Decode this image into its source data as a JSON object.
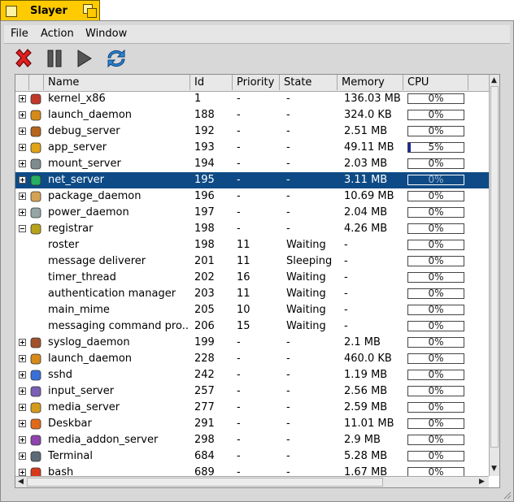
{
  "window": {
    "title": "Slayer"
  },
  "menu": [
    "File",
    "Action",
    "Window"
  ],
  "toolbar": [
    {
      "name": "kill-icon",
      "tip": "Kill"
    },
    {
      "name": "pause-icon",
      "tip": "Suspend"
    },
    {
      "name": "play-icon",
      "tip": "Resume"
    },
    {
      "name": "refresh-icon",
      "tip": "Refresh"
    }
  ],
  "columns": [
    "Name",
    "Id",
    "Priority",
    "State",
    "Memory",
    "CPU"
  ],
  "colors": {
    "selection": "#0e4b86",
    "tab": "#ffcb00",
    "cpu_fill": "#1a2a9a"
  },
  "rows": [
    {
      "type": "team",
      "expander": "plus",
      "icon": "kernel-icon",
      "name": "kernel_x86",
      "id": "1",
      "priority": "-",
      "state": "-",
      "memory": "136.03 MB",
      "cpu": "0%",
      "cpu_value": 0
    },
    {
      "type": "team",
      "expander": "plus",
      "icon": "daemon-icon",
      "name": "launch_daemon",
      "id": "188",
      "priority": "-",
      "state": "-",
      "memory": "324.0 KB",
      "cpu": "0%",
      "cpu_value": 0
    },
    {
      "type": "team",
      "expander": "plus",
      "icon": "debug-icon",
      "name": "debug_server",
      "id": "192",
      "priority": "-",
      "state": "-",
      "memory": "2.51 MB",
      "cpu": "0%",
      "cpu_value": 0
    },
    {
      "type": "team",
      "expander": "plus",
      "icon": "app-server-icon",
      "name": "app_server",
      "id": "193",
      "priority": "-",
      "state": "-",
      "memory": "49.11 MB",
      "cpu": "5%",
      "cpu_value": 0.05
    },
    {
      "type": "team",
      "expander": "plus",
      "icon": "disk-icon",
      "name": "mount_server",
      "id": "194",
      "priority": "-",
      "state": "-",
      "memory": "2.03 MB",
      "cpu": "0%",
      "cpu_value": 0
    },
    {
      "type": "team",
      "expander": "plus",
      "icon": "globe-icon",
      "name": "net_server",
      "id": "195",
      "priority": "-",
      "state": "-",
      "memory": "3.11 MB",
      "cpu": "0%",
      "cpu_value": 0,
      "selected": true
    },
    {
      "type": "team",
      "expander": "plus",
      "icon": "package-icon",
      "name": "package_daemon",
      "id": "196",
      "priority": "-",
      "state": "-",
      "memory": "10.69 MB",
      "cpu": "0%",
      "cpu_value": 0
    },
    {
      "type": "team",
      "expander": "plus",
      "icon": "power-icon",
      "name": "power_daemon",
      "id": "197",
      "priority": "-",
      "state": "-",
      "memory": "2.04 MB",
      "cpu": "0%",
      "cpu_value": 0
    },
    {
      "type": "team",
      "expander": "minus",
      "icon": "registrar-icon",
      "name": "registrar",
      "id": "198",
      "priority": "-",
      "state": "-",
      "memory": "4.26 MB",
      "cpu": "0%",
      "cpu_value": 0
    },
    {
      "type": "thread",
      "name": "roster",
      "id": "198",
      "priority": "11",
      "state": "Waiting",
      "memory": "-",
      "cpu": "0%",
      "cpu_value": 0
    },
    {
      "type": "thread",
      "name": "message deliverer",
      "id": "201",
      "priority": "11",
      "state": "Sleeping",
      "memory": "-",
      "cpu": "0%",
      "cpu_value": 0
    },
    {
      "type": "thread",
      "name": "timer_thread",
      "id": "202",
      "priority": "16",
      "state": "Waiting",
      "memory": "-",
      "cpu": "0%",
      "cpu_value": 0
    },
    {
      "type": "thread",
      "name": "authentication manager",
      "id": "203",
      "priority": "11",
      "state": "Waiting",
      "memory": "-",
      "cpu": "0%",
      "cpu_value": 0
    },
    {
      "type": "thread",
      "name": "main_mime",
      "id": "205",
      "priority": "10",
      "state": "Waiting",
      "memory": "-",
      "cpu": "0%",
      "cpu_value": 0
    },
    {
      "type": "thread",
      "name": "messaging command pro...",
      "id": "206",
      "priority": "15",
      "state": "Waiting",
      "memory": "-",
      "cpu": "0%",
      "cpu_value": 0
    },
    {
      "type": "team",
      "expander": "plus",
      "icon": "syslog-icon",
      "name": "syslog_daemon",
      "id": "199",
      "priority": "-",
      "state": "-",
      "memory": "2.1 MB",
      "cpu": "0%",
      "cpu_value": 0
    },
    {
      "type": "team",
      "expander": "plus",
      "icon": "daemon-icon",
      "name": "launch_daemon",
      "id": "228",
      "priority": "-",
      "state": "-",
      "memory": "460.0 KB",
      "cpu": "0%",
      "cpu_value": 0
    },
    {
      "type": "team",
      "expander": "plus",
      "icon": "sshd-icon",
      "name": "sshd",
      "id": "242",
      "priority": "-",
      "state": "-",
      "memory": "1.19 MB",
      "cpu": "0%",
      "cpu_value": 0
    },
    {
      "type": "team",
      "expander": "plus",
      "icon": "input-icon",
      "name": "input_server",
      "id": "257",
      "priority": "-",
      "state": "-",
      "memory": "2.56 MB",
      "cpu": "0%",
      "cpu_value": 0
    },
    {
      "type": "team",
      "expander": "plus",
      "icon": "media-icon",
      "name": "media_server",
      "id": "277",
      "priority": "-",
      "state": "-",
      "memory": "2.59 MB",
      "cpu": "0%",
      "cpu_value": 0
    },
    {
      "type": "team",
      "expander": "plus",
      "icon": "deskbar-icon",
      "name": "Deskbar",
      "id": "291",
      "priority": "-",
      "state": "-",
      "memory": "11.01 MB",
      "cpu": "0%",
      "cpu_value": 0
    },
    {
      "type": "team",
      "expander": "plus",
      "icon": "media-addon-icon",
      "name": "media_addon_server",
      "id": "298",
      "priority": "-",
      "state": "-",
      "memory": "2.9 MB",
      "cpu": "0%",
      "cpu_value": 0
    },
    {
      "type": "team",
      "expander": "plus",
      "icon": "terminal-icon",
      "name": "Terminal",
      "id": "684",
      "priority": "-",
      "state": "-",
      "memory": "5.28 MB",
      "cpu": "0%",
      "cpu_value": 0
    },
    {
      "type": "team",
      "expander": "plus",
      "icon": "bash-icon",
      "name": "bash",
      "id": "689",
      "priority": "-",
      "state": "-",
      "memory": "1.67 MB",
      "cpu": "0%",
      "cpu_value": 0
    }
  ]
}
